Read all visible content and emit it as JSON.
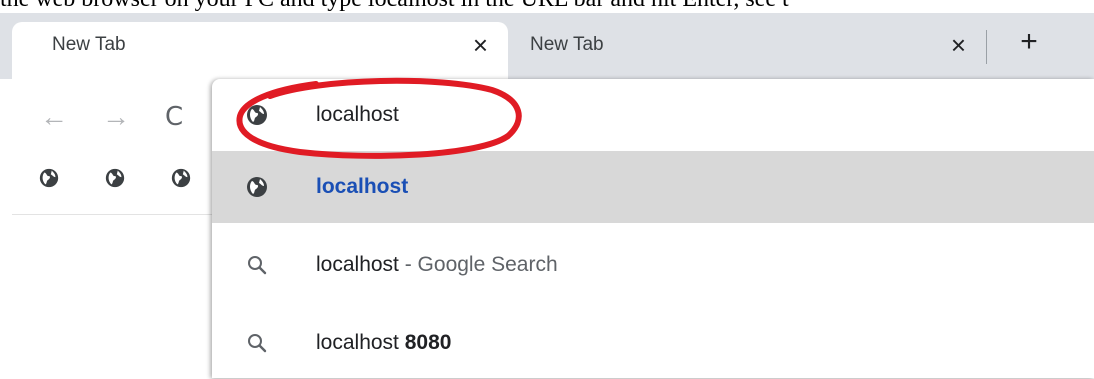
{
  "caption": "the web browser on your PC and type localhost in the URL bar and hit Enter, see t",
  "tabs": [
    {
      "title": "New Tab",
      "close": "×",
      "active": true
    },
    {
      "title": "New Tab",
      "close": "×",
      "active": false
    }
  ],
  "new_tab_label": "+",
  "toolbar": {
    "back": "←",
    "forward": "→",
    "reload": "C"
  },
  "suggestions": [
    {
      "icon": "globe-icon",
      "text": "localhost",
      "selected": false
    },
    {
      "icon": "globe-icon",
      "text": "localhost",
      "selected": true,
      "style": "link"
    },
    {
      "icon": "search-icon",
      "text": "localhost",
      "suffix": " - Google Search",
      "selected": false
    },
    {
      "icon": "search-icon",
      "text": "localhost",
      "bold_suffix": "8080",
      "selected": false
    }
  ],
  "colors": {
    "tabstrip": "#dee1e6",
    "selected_row": "#d8d8d8",
    "link_text": "#1a4fb5",
    "annotation": "#e01b24"
  }
}
